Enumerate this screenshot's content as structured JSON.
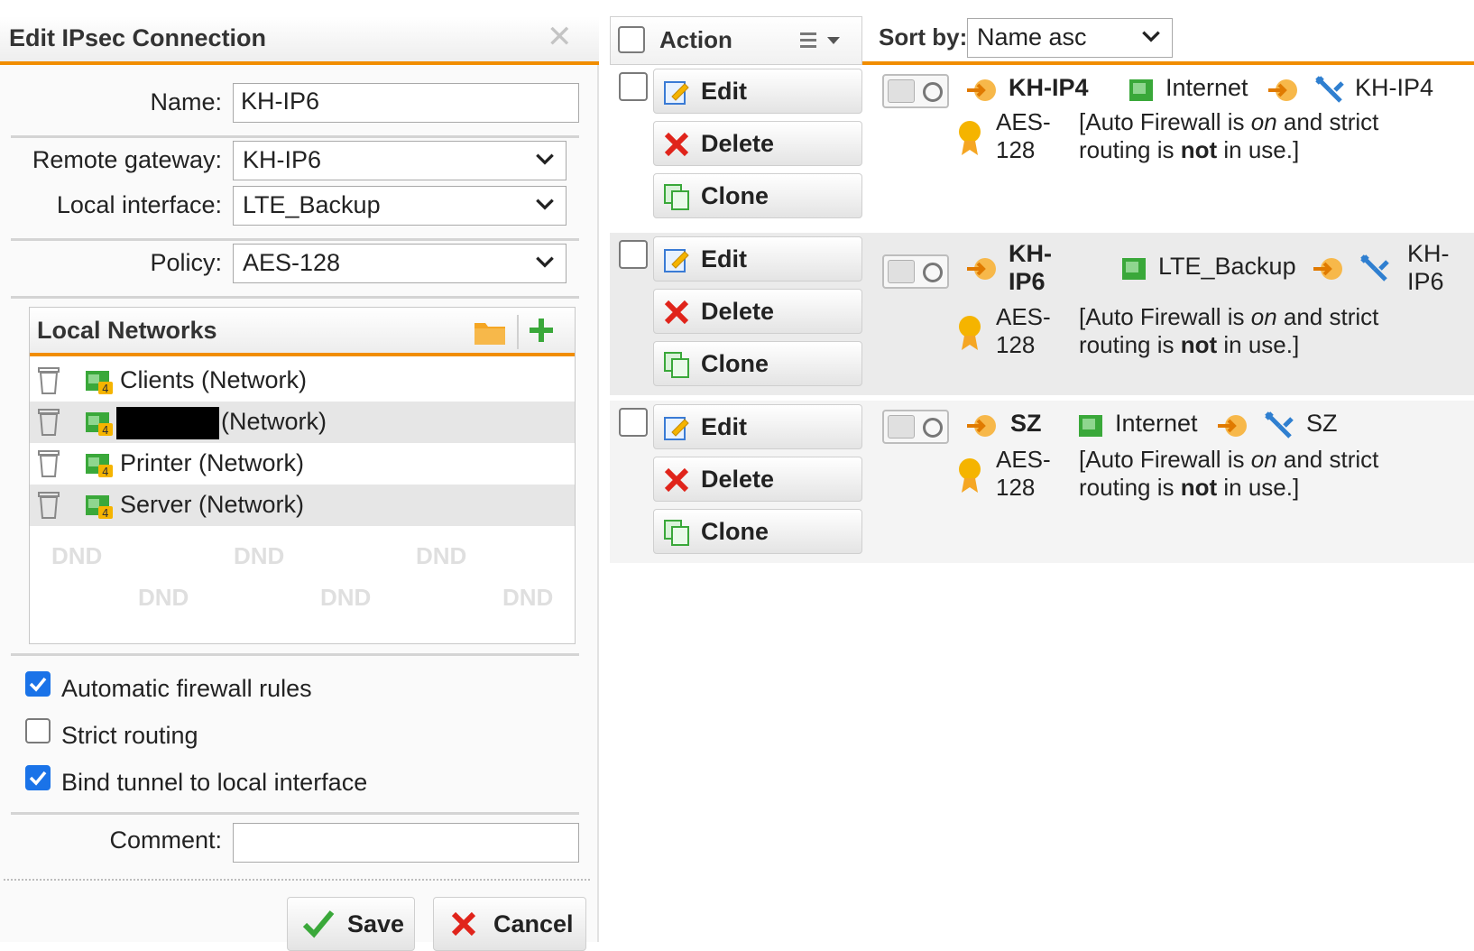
{
  "dialog": {
    "title": "Edit IPsec Connection",
    "name_label": "Name:",
    "name_value": "KH-IP6",
    "remote_gateway_label": "Remote gateway:",
    "remote_gateway_value": "KH-IP6",
    "local_interface_label": "Local interface:",
    "local_interface_value": "LTE_Backup",
    "policy_label": "Policy:",
    "policy_value": "AES-128",
    "local_networks": {
      "title": "Local Networks",
      "items": [
        {
          "label": "Clients (Network)"
        },
        {
          "label": "(Network)"
        },
        {
          "label": "Printer (Network)"
        },
        {
          "label": "Server (Network)"
        }
      ],
      "dnd_label": "DND"
    },
    "options": {
      "auto_firewall": {
        "label": "Automatic firewall rules",
        "checked": true
      },
      "strict_routing": {
        "label": "Strict routing",
        "checked": false
      },
      "bind_tunnel": {
        "label": "Bind tunnel to local interface",
        "checked": true
      }
    },
    "comment_label": "Comment:",
    "comment_value": "",
    "save_label": "Save",
    "cancel_label": "Cancel"
  },
  "toolbar": {
    "action_label": "Action",
    "sort_label": "Sort by:",
    "sort_value": "Name asc"
  },
  "buttons": {
    "edit": "Edit",
    "delete": "Delete",
    "clone": "Clone"
  },
  "desc_text": {
    "part1": "[Auto Firewall is ",
    "part2": "on",
    "part3": " and strict",
    "part4": "routing is ",
    "part5": "not",
    "part6": " in use.]"
  },
  "connections": [
    {
      "name": "KH-IP4",
      "interface": "Internet",
      "gateway": "KH-IP4",
      "policy_a": "AES-",
      "policy_b": "128"
    },
    {
      "name_a": "KH-",
      "name_b": "IP6",
      "interface": "LTE_Backup",
      "gateway_a": "KH-",
      "gateway_b": "IP6",
      "policy_a": "AES-",
      "policy_b": "128"
    },
    {
      "name": "SZ",
      "interface": "Internet",
      "gateway": "SZ",
      "policy_a": "AES-",
      "policy_b": "128"
    }
  ],
  "colors": {
    "accent": "#f18d00",
    "checkbox": "#1a73e8",
    "network_icon": "#3aa83a",
    "delete_red": "#e0241b"
  }
}
